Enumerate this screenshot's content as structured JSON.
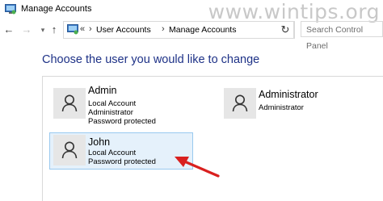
{
  "window": {
    "title": "Manage Accounts",
    "title_icon": "control-panel-icon"
  },
  "watermark": "www.wintips.org",
  "nav": {
    "back_icon": "arrow-left-icon",
    "forward_icon": "arrow-right-icon",
    "recent_icon": "chevron-down-icon",
    "up_icon": "arrow-up-icon",
    "address": {
      "overflow": "«",
      "crumbs": [
        "User Accounts",
        "Manage Accounts"
      ],
      "separator": "›"
    },
    "refresh_icon": "refresh-icon",
    "search_placeholder": "Search Control Panel"
  },
  "heading": "Choose the user you would like to change",
  "accounts": [
    {
      "name": "Admin",
      "lines": [
        "Local Account",
        "Administrator",
        "Password protected"
      ],
      "selected": false
    },
    {
      "name": "Administrator",
      "lines": [
        "Administrator"
      ],
      "selected": false
    },
    {
      "name": "John",
      "lines": [
        "Local Account",
        "Password protected"
      ],
      "selected": true
    }
  ],
  "colors": {
    "heading": "#1e3287",
    "selection_bg": "#e5f1fb",
    "selection_border": "#99c9ef",
    "arrow": "#d9201f"
  }
}
